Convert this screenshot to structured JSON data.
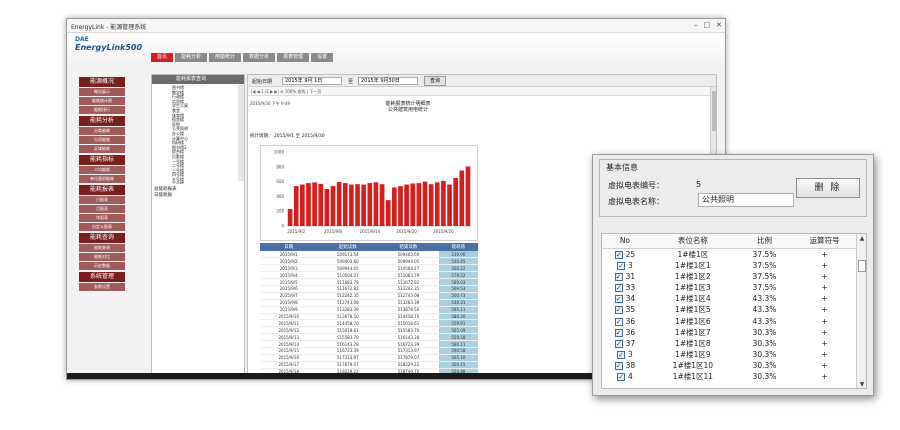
{
  "window": {
    "title": "EnergyLink - 能源管理系统"
  },
  "app": {
    "logo_top": "DAE",
    "logo_brand": "EnergyLink500"
  },
  "topnav": [
    "首页",
    "能耗分析",
    "用能统计",
    "数据分析",
    "报表管理",
    "设置"
  ],
  "sidebar": [
    {
      "head": "能源概况",
      "items": [
        "概况展示",
        "能耗统计图",
        "能耗排行"
      ]
    },
    {
      "head": "能耗分析",
      "items": [
        "分类能耗",
        "分项能耗",
        "区域能耗"
      ]
    },
    {
      "head": "能耗指标",
      "items": [
        "人均能耗",
        "单位面积能耗"
      ]
    },
    {
      "head": "能耗报表",
      "items": [
        "日报表",
        "月报表",
        "年报表",
        "自定义报表"
      ]
    },
    {
      "head": "能耗查询",
      "items": [
        "能耗查询",
        "能耗对比",
        "历史数据"
      ]
    },
    {
      "head": "系统管理",
      "items": [
        "参数设置"
      ]
    }
  ],
  "tree": {
    "title": "能耗报表查询",
    "nodes": [
      "图书馆",
      "教学楼",
      "行政楼",
      "实验楼",
      "学生公寓",
      "食堂",
      "体育馆",
      "宿舍楼",
      "医院",
      "公共照明",
      "办公楼",
      "计算中心",
      "科研楼",
      "图书馆2",
      "综合楼",
      "后勤楼",
      "一号楼",
      "二号楼",
      "三号楼",
      "四号楼",
      "五号楼",
      "六号楼",
      "七号楼",
      "八号楼"
    ],
    "sub": [
      "总能耗报表",
      "日能耗报"
    ]
  },
  "filter": {
    "start_label": "起始日期",
    "start_value": "2015年 9月 1日",
    "end_label": "至",
    "end_value": "2015年 9月30日",
    "query_button": "查询"
  },
  "report": {
    "toolbar": "|◀ ◀ 1 /1 ▶ ▶| ⊕ 100% 查找 | 下一页",
    "meta": "2015/9/30 下午 9:49",
    "title_line1": "能耗报表统计明细表",
    "title_line2": "公共建筑用电统计",
    "period_label": "统计周期：",
    "period_value": "2015/9/1 至 2015/9/30"
  },
  "chart_data": {
    "type": "bar",
    "categories": [
      "2015/9/1",
      "2015/9/2",
      "2015/9/3",
      "2015/9/4",
      "2015/9/5",
      "2015/9/6",
      "2015/9/7",
      "2015/9/8",
      "2015/9/9",
      "2015/9/10",
      "2015/9/11",
      "2015/9/12",
      "2015/9/13",
      "2015/9/14",
      "2015/9/15",
      "2015/9/16",
      "2015/9/17",
      "2015/9/18",
      "2015/9/19",
      "2015/9/20",
      "2015/9/21",
      "2015/9/22",
      "2015/9/23",
      "2015/9/24",
      "2015/9/25",
      "2015/9/26",
      "2015/9/27",
      "2015/9/28",
      "2015/9/29",
      "2015/9/30"
    ],
    "values": [
      230,
      540,
      560,
      580,
      590,
      570,
      500,
      540,
      595,
      580,
      560,
      565,
      560,
      580,
      590,
      565,
      350,
      520,
      540,
      560,
      575,
      580,
      600,
      565,
      590,
      610,
      560,
      650,
      750,
      805
    ],
    "ylim": [
      0,
      1000
    ],
    "yticks": [
      0,
      200,
      400,
      600,
      800,
      1000
    ],
    "xticks": [
      "2015/9/2",
      "2015/9/8",
      "2015/9/14",
      "2015/9/20",
      "2015/9/26"
    ],
    "colors": {
      "bar": "#d41f1f"
    }
  },
  "table": {
    "headers": [
      "日期",
      "起始读数",
      "结束读数",
      "能耗值"
    ],
    "rows": [
      [
        "2015/9/1",
        "509173.54",
        "509403.60",
        "230.06"
      ],
      [
        "2015/9/2",
        "509403.60",
        "509944.05",
        "540.45"
      ],
      [
        "2015/9/3",
        "509944.05",
        "510504.27",
        "560.22"
      ],
      [
        "2015/9/4",
        "510504.27",
        "511083.79",
        "579.52"
      ],
      [
        "2015/9/5",
        "511083.79",
        "511672.82",
        "589.03"
      ],
      [
        "2015/9/6",
        "511672.82",
        "512242.35",
        "569.53"
      ],
      [
        "2015/9/7",
        "512242.35",
        "512743.08",
        "500.73"
      ],
      [
        "2015/9/8",
        "512743.08",
        "513283.39",
        "540.31"
      ],
      [
        "2015/9/9",
        "513283.39",
        "513878.50",
        "595.11"
      ],
      [
        "2015/9/10",
        "513878.50",
        "514458.70",
        "580.20"
      ],
      [
        "2015/9/11",
        "514458.70",
        "515018.61",
        "559.91"
      ],
      [
        "2015/9/12",
        "515018.61",
        "515583.70",
        "565.09"
      ],
      [
        "2015/9/13",
        "515583.70",
        "516143.28",
        "559.58"
      ],
      [
        "2015/9/14",
        "516143.28",
        "516723.39",
        "580.11"
      ],
      [
        "2015/9/15",
        "516723.39",
        "517313.97",
        "590.58"
      ],
      [
        "2015/9/16",
        "517313.97",
        "517879.07",
        "565.10"
      ],
      [
        "2015/9/17",
        "517879.07",
        "518229.22",
        "350.15"
      ],
      [
        "2015/9/18",
        "518229.22",
        "518749.70",
        "520.48"
      ],
      [
        "2015/9/19",
        "518749.70",
        "519289.86",
        "540.16"
      ],
      [
        "2015/9/20",
        "519289.86",
        "519849.99",
        "560.13"
      ]
    ]
  },
  "dialog": {
    "group_title": "基本信息",
    "label_count": "虚拟电表编号：",
    "value_count": "5",
    "label_name": "虚拟电表名称：",
    "value_name": "公共照明",
    "delete_button": "删 除",
    "list_headers": [
      "No",
      "表位名称",
      "比例",
      "运算符号"
    ],
    "rows": [
      [
        "25",
        "1#楼1区",
        "37.5%",
        "+"
      ],
      [
        "3",
        "1#楼1区1",
        "37.5%",
        "+"
      ],
      [
        "31",
        "1#楼1区2",
        "37.5%",
        "+"
      ],
      [
        "33",
        "1#楼1区3",
        "37.5%",
        "+"
      ],
      [
        "34",
        "1#楼1区4",
        "43.3%",
        "+"
      ],
      [
        "35",
        "1#楼1区5",
        "43.3%",
        "+"
      ],
      [
        "36",
        "1#楼1区6",
        "43.3%",
        "+"
      ],
      [
        "36",
        "1#楼1区7",
        "30.3%",
        "+"
      ],
      [
        "37",
        "1#楼1区8",
        "30.3%",
        "+"
      ],
      [
        "3",
        "1#楼1区9",
        "30.3%",
        "+"
      ],
      [
        "38",
        "1#楼1区10",
        "30.3%",
        "+"
      ],
      [
        "4",
        "1#楼1区11",
        "30.3%",
        "+"
      ]
    ]
  }
}
